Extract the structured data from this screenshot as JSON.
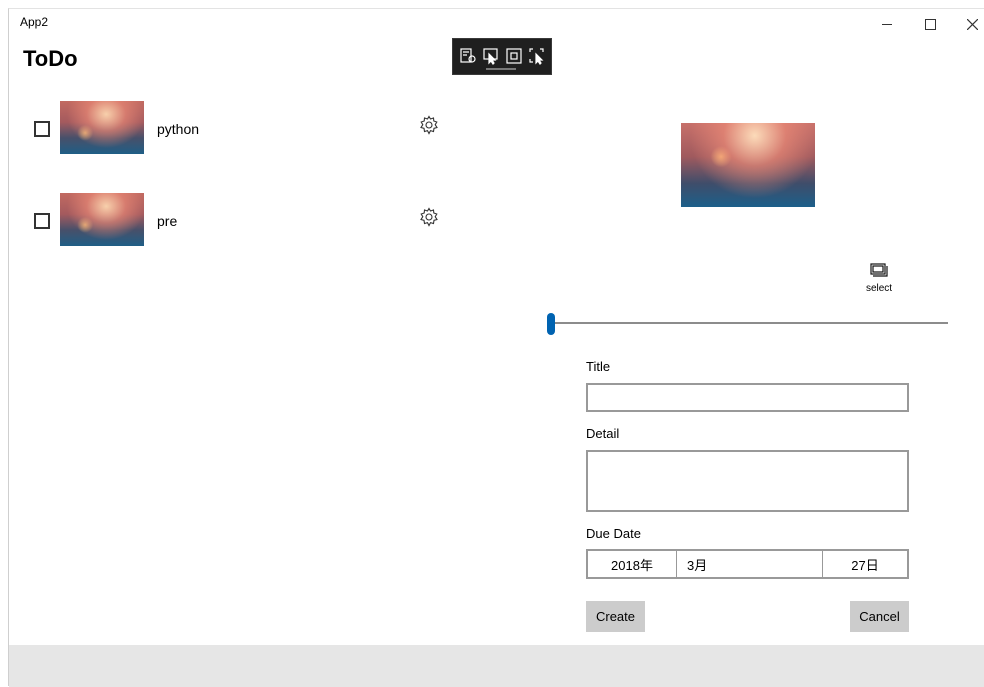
{
  "window": {
    "title": "App2"
  },
  "page": {
    "heading": "ToDo"
  },
  "dev_toolbar": {
    "tools": [
      "live-visual-tree-icon",
      "select-element-icon",
      "display-layout-adorners-icon",
      "track-focus-icon"
    ]
  },
  "todos": [
    {
      "label": "python",
      "checked": false
    },
    {
      "label": "pre",
      "checked": false
    }
  ],
  "editor": {
    "select_label": "select",
    "slider_value_percent": 0,
    "title_label": "Title",
    "title_value": "",
    "detail_label": "Detail",
    "detail_value": "",
    "due_date_label": "Due Date",
    "date": {
      "year": "2018年",
      "month": "3月",
      "day": "27日"
    },
    "create_label": "Create",
    "cancel_label": "Cancel"
  },
  "colors": {
    "accent": "#0063b1",
    "button_bg": "#cccccc",
    "footer_bg": "#e6e6e6"
  }
}
